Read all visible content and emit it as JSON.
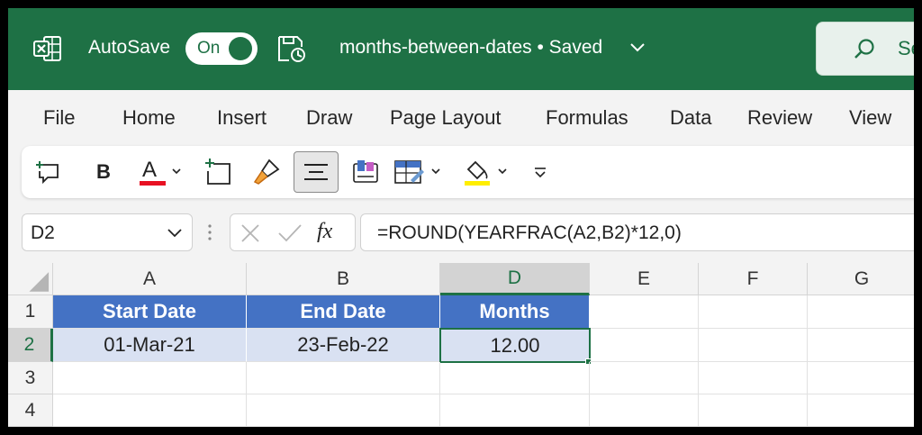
{
  "titlebar": {
    "autosave_label": "AutoSave",
    "autosave_state": "On",
    "document_title": "months-between-dates • Saved",
    "search_text": "Se",
    "accent_color": "#1e7145"
  },
  "ribbon": {
    "tabs": [
      "File",
      "Home",
      "Insert",
      "Draw",
      "Page Layout",
      "Formulas",
      "Data",
      "Review",
      "View"
    ],
    "active_tab": "File"
  },
  "toolbar": {
    "bold_label": "B",
    "font_color_glyph": "A",
    "font_color": "#e81123",
    "highlight_color": "#ffee00"
  },
  "formula_bar": {
    "name_box": "D2",
    "fx_label": "fx",
    "formula": "=ROUND(YEARFRAC(A2,B2)*12,0)"
  },
  "grid": {
    "columns": [
      "A",
      "B",
      "D",
      "E",
      "F",
      "G"
    ],
    "selected_column": "D",
    "rows": [
      "1",
      "2",
      "3",
      "4"
    ],
    "selected_row": "2",
    "header_row": [
      "Start Date",
      "End Date",
      "Months"
    ],
    "data_row": [
      "01-Mar-21",
      "23-Feb-22",
      "12.00"
    ],
    "active_cell": "D2"
  }
}
